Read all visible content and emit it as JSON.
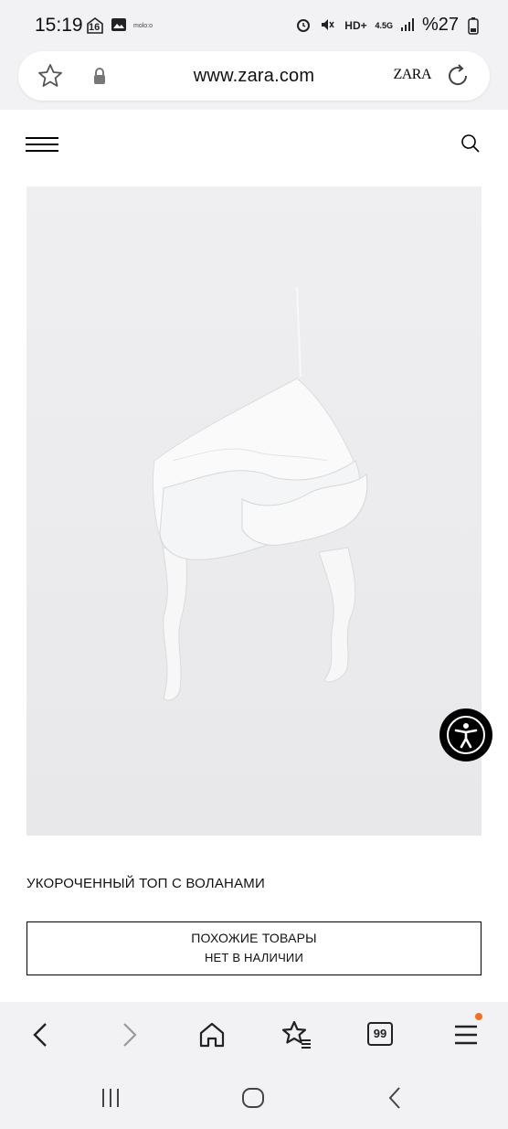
{
  "status_bar": {
    "time": "15:19",
    "calendar_day": "16",
    "small_label": "molo:o",
    "network": "4.5G",
    "battery": "%27"
  },
  "browser": {
    "url": "www.zara.com",
    "site_logo": "ZARA",
    "tabs_count": "99"
  },
  "product": {
    "name": "УКОРОЧЕННЫЙ ТОП С ВОЛАНАМИ",
    "similar_label": "ПОХОЖИЕ ТОВАРЫ",
    "availability": "НЕТ В НАЛИЧИИ"
  },
  "colors": {
    "image_background": "#ececee",
    "chrome_background": "#f2f2f4",
    "notification_dot": "#f27127"
  },
  "icons": [
    "star-icon",
    "lock-icon",
    "reload-icon",
    "hamburger-icon",
    "search-icon",
    "accessibility-icon",
    "back-icon",
    "forward-icon",
    "home-icon",
    "bookmarks-icon",
    "tabs-icon",
    "menu-icon",
    "recent-apps-icon",
    "home-nav-icon",
    "back-nav-icon"
  ]
}
